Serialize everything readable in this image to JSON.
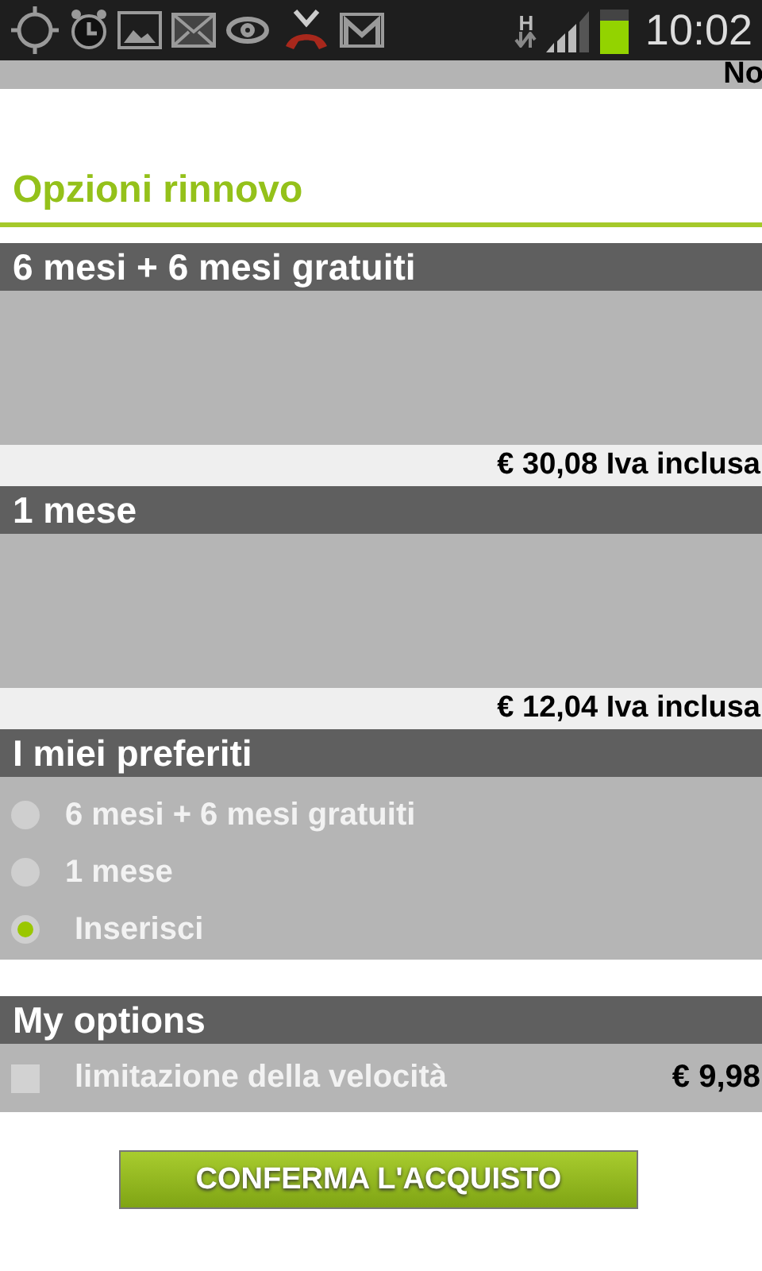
{
  "status_bar": {
    "network": "H",
    "time": "10:02"
  },
  "top_strip": {
    "text": "No"
  },
  "title": "Opzioni rinnovo",
  "plans": [
    {
      "name": "6 mesi + 6 mesi gratuiti",
      "price": "€ 30,08 Iva inclusa"
    },
    {
      "name": "1 mese",
      "price": "€ 12,04 Iva inclusa"
    }
  ],
  "favorites": {
    "title": "I miei preferiti",
    "options": [
      {
        "label": "6 mesi + 6 mesi gratuiti",
        "selected": false
      },
      {
        "label": "1 mese",
        "selected": false
      },
      {
        "label": "Inserisci",
        "selected": true
      }
    ]
  },
  "my_options": {
    "title": "My options",
    "items": [
      {
        "label": "limitazione della velocità",
        "price": "€ 9,98",
        "checked": false
      }
    ]
  },
  "confirm_button": "CONFERMA L'ACQUISTO"
}
